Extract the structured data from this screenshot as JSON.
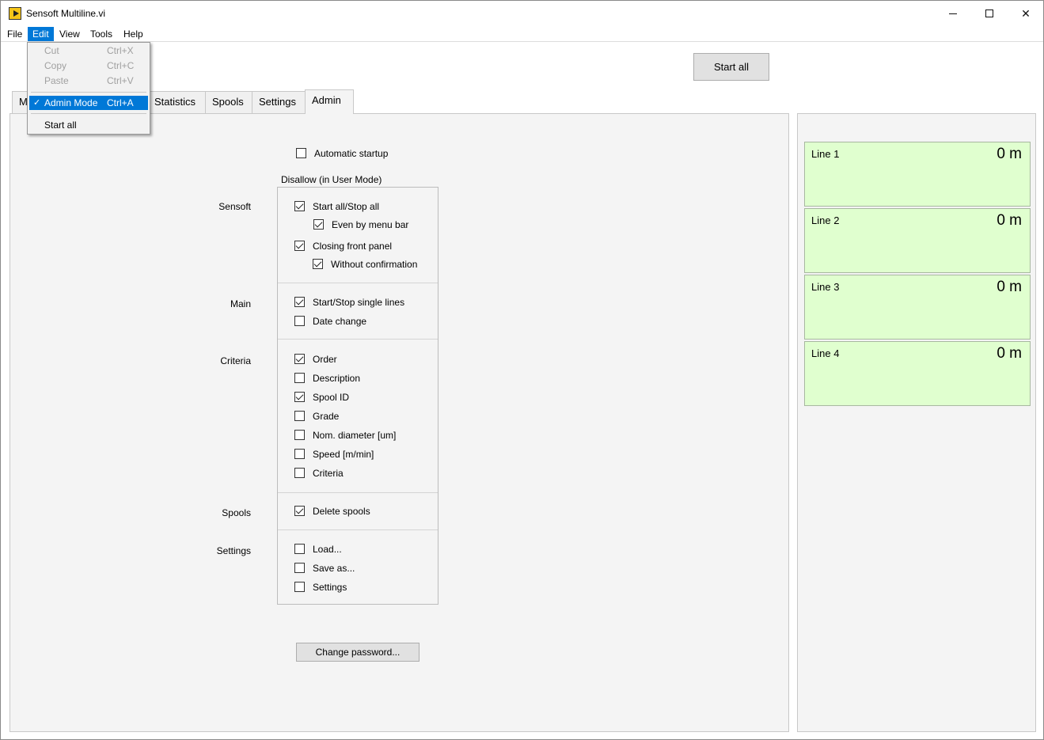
{
  "window": {
    "title": "Sensoft Multiline.vi"
  },
  "menubar": {
    "file": "File",
    "edit": "Edit",
    "view": "View",
    "tools": "Tools",
    "help": "Help"
  },
  "edit_menu": {
    "cut": "Cut",
    "cut_sc": "Ctrl+X",
    "copy": "Copy",
    "copy_sc": "Ctrl+C",
    "paste": "Paste",
    "paste_sc": "Ctrl+V",
    "admin_mode": "Admin Mode",
    "admin_mode_sc": "Ctrl+A",
    "admin_check": "✓",
    "start_all": "Start all"
  },
  "toolbar": {
    "start_all": "Start all"
  },
  "tabs": {
    "main": "M",
    "statistics": "Statistics",
    "spools": "Spools",
    "settings": "Settings",
    "admin": "Admin"
  },
  "admin": {
    "automatic_startup": "Automatic startup",
    "group_title": "Disallow (in User Mode)",
    "sections": {
      "sensoft": "Sensoft",
      "main": "Main",
      "criteria": "Criteria",
      "spools": "Spools",
      "settings": "Settings"
    },
    "options": {
      "start_stop_all": "Start all/Stop all",
      "even_by_menu_bar": "Even by menu bar",
      "closing_front_panel": "Closing front panel",
      "without_confirmation": "Without confirmation",
      "start_stop_single": "Start/Stop single lines",
      "date_change": "Date change",
      "order": "Order",
      "description": "Description",
      "spool_id": "Spool ID",
      "grade": "Grade",
      "nom_diameter": "Nom. diameter [um]",
      "speed": "Speed [m/min]",
      "criteria": "Criteria",
      "delete_spools": "Delete spools",
      "load": "Load...",
      "save_as": "Save as...",
      "settings": "Settings"
    },
    "change_password": "Change password..."
  },
  "lines": [
    {
      "name": "Line 1",
      "value": "0 m"
    },
    {
      "name": "Line 2",
      "value": "0 m"
    },
    {
      "name": "Line 3",
      "value": "0 m"
    },
    {
      "name": "Line 4",
      "value": "0 m"
    }
  ],
  "colors": {
    "line_card_bg": "#e0ffcf",
    "menu_highlight": "#0078d7"
  }
}
